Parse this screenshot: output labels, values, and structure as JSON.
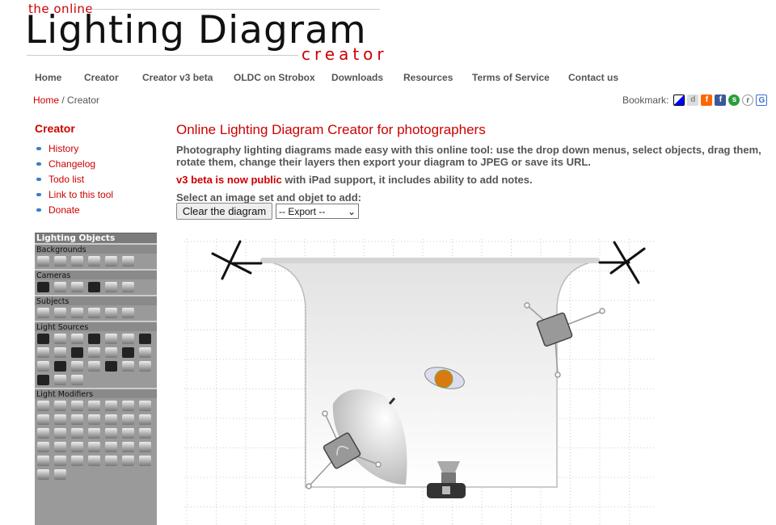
{
  "logo": {
    "small": "the online",
    "big": "Lighting Diagram",
    "sub": "creator"
  },
  "nav": [
    "Home",
    "Creator",
    "Creator v3 beta",
    "OLDC on Strobox",
    "Downloads",
    "Resources",
    "Terms of Service",
    "Contact us"
  ],
  "breadcrumb": {
    "home": "Home",
    "sep": " / ",
    "current": "Creator"
  },
  "bookmark": {
    "label": "Bookmark:",
    "icons": [
      "delicious-icon",
      "digg-icon",
      "friendfeed-icon",
      "facebook-icon",
      "stumbleupon-icon",
      "reddit-icon",
      "google-icon"
    ]
  },
  "sidebar": {
    "title": "Creator",
    "links": [
      "History",
      "Changelog",
      "Todo list",
      "Link to this tool",
      "Donate"
    ]
  },
  "panel": {
    "title": "Lighting Objects",
    "sections": [
      {
        "name": "Backgrounds",
        "count": 6
      },
      {
        "name": "Cameras",
        "count": 6
      },
      {
        "name": "Subjects",
        "count": 6
      },
      {
        "name": "Light Sources",
        "count": 24
      },
      {
        "name": "Light Modifiers",
        "count": 37
      }
    ]
  },
  "main": {
    "title": "Online Lighting Diagram Creator for photographers",
    "intro": "Photography lighting diagrams made easy with this online tool: use the drop down menus, select objects, drag them, rotate them, change their layers then export your diagram to JPEG or save its URL.",
    "beta_link": "v3 beta is now public",
    "beta_text": " with iPad support, it includes ability to add notes.",
    "select_label": "Select an image set and objet to add:",
    "clear_button": "Clear the diagram",
    "export_select": "-- Export --"
  },
  "colors": {
    "accent": "#cc0000",
    "nav_text": "#555555",
    "panel": "#9a9a9a"
  }
}
